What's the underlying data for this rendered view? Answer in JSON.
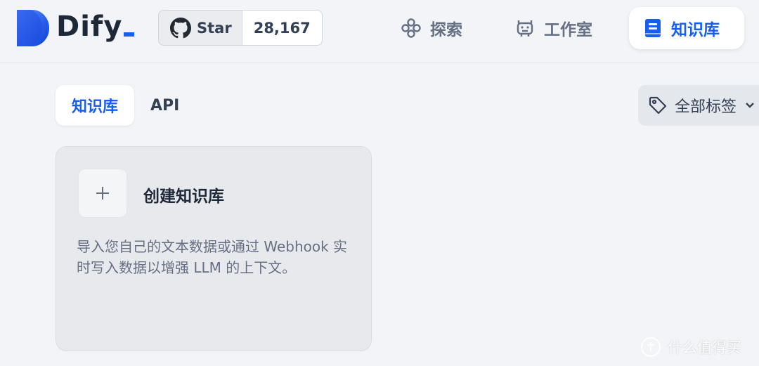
{
  "app": {
    "name": "Dify"
  },
  "github": {
    "label": "Star",
    "count": "28,167"
  },
  "nav": [
    {
      "label": "探索",
      "icon": "explore-icon",
      "active": false
    },
    {
      "label": "工作室",
      "icon": "robot-icon",
      "active": false
    },
    {
      "label": "知识库",
      "icon": "book-icon",
      "active": true
    }
  ],
  "tabs": [
    {
      "label": "知识库",
      "active": true
    },
    {
      "label": "API",
      "active": false
    }
  ],
  "tag_filter": {
    "label": "全部标签",
    "icon": "tag-icon"
  },
  "create_card": {
    "title": "创建知识库",
    "description": "导入您自己的文本数据或通过 Webhook 实时写入数据以增强 LLM 的上下文。"
  },
  "watermark": {
    "text": "什么值得买"
  },
  "colors": {
    "accent": "#155eef",
    "background": "#f2f4f7",
    "card": "#e8e9ed",
    "muted_text": "#667085"
  }
}
